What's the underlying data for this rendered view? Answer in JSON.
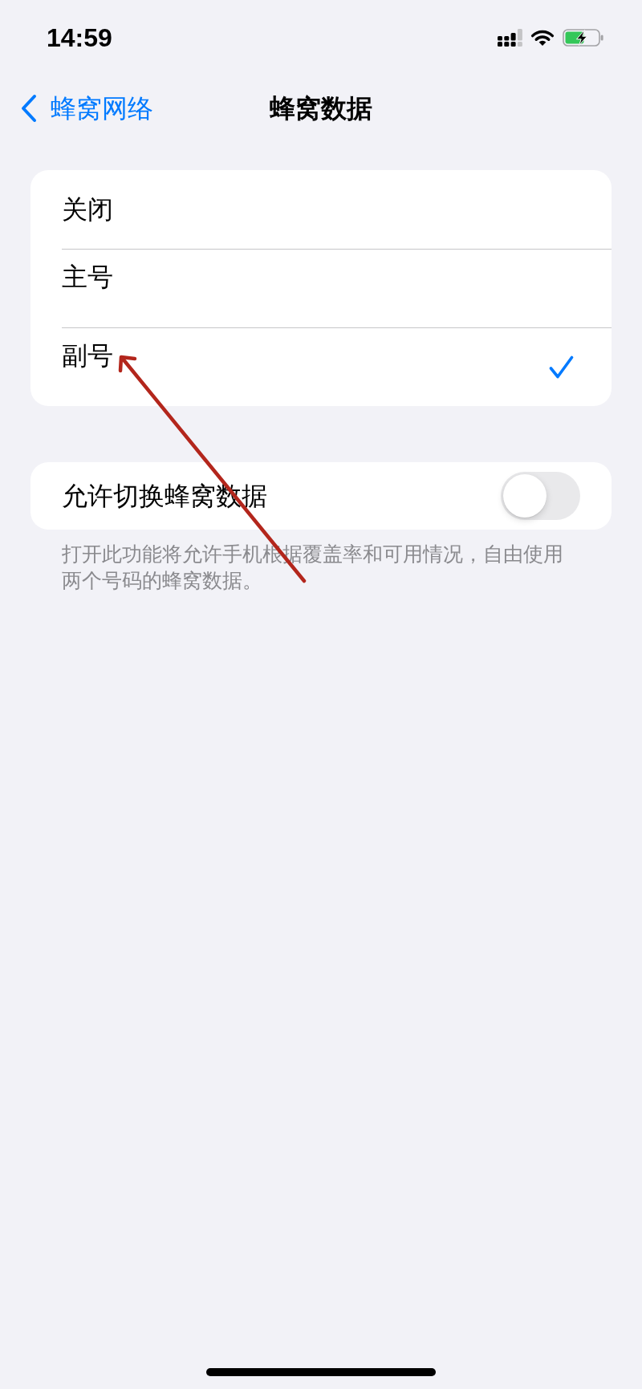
{
  "status_bar": {
    "time": "14:59"
  },
  "nav": {
    "back_label": "蜂窝网络",
    "title": "蜂窝数据"
  },
  "options": [
    {
      "label": "关闭",
      "selected": false
    },
    {
      "label": "主号",
      "selected": false
    },
    {
      "label": "副号",
      "selected": true
    }
  ],
  "switch_row": {
    "label": "允许切换蜂窝数据",
    "on": false
  },
  "footer": "打开此功能将允许手机根据覆盖率和可用情况，自由使用两个号码的蜂窝数据。"
}
